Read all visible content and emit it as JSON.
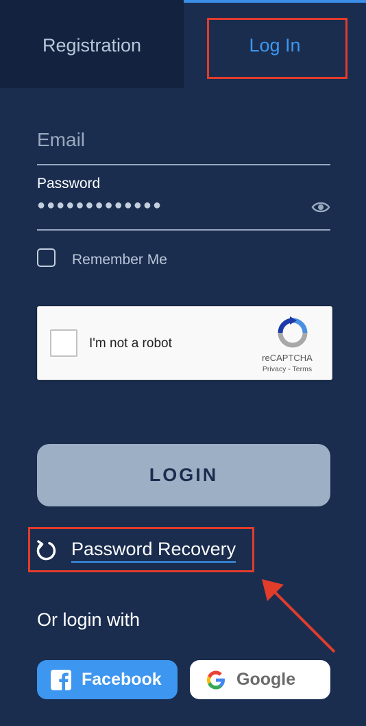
{
  "tabs": {
    "registration": "Registration",
    "login": "Log In"
  },
  "form": {
    "email_placeholder": "Email",
    "password_label": "Password",
    "password_masked": "●●●●●●●●●●●●●",
    "remember_label": "Remember Me"
  },
  "captcha": {
    "label": "I'm not a robot",
    "brand": "reCAPTCHA",
    "links": "Privacy - Terms"
  },
  "login_button": "LOGIN",
  "recovery_link": "Password Recovery",
  "social": {
    "heading": "Or login with",
    "facebook": "Facebook",
    "google": "Google"
  },
  "icons": {
    "eye": "eye-icon",
    "recovery": "refresh-icon",
    "facebook": "facebook-icon",
    "google": "google-icon",
    "captcha": "recaptcha-icon"
  },
  "colors": {
    "background": "#1a2d4f",
    "accent": "#3d96ef",
    "highlight": "#e23c2b",
    "button": "#9dafc5"
  }
}
